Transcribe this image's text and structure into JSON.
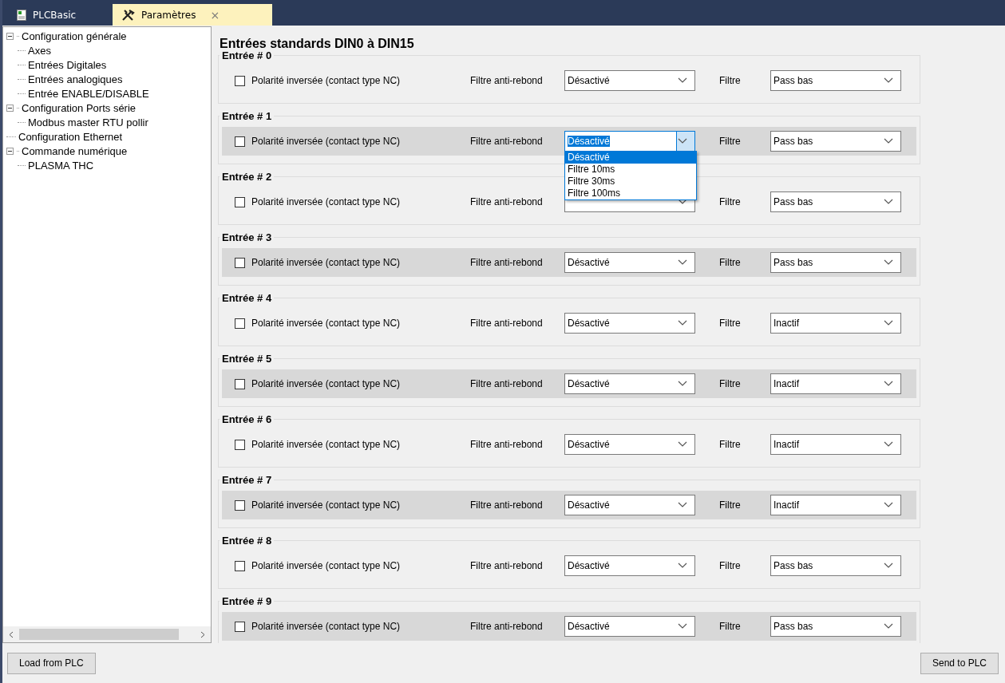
{
  "tabs": [
    {
      "label": "PLCBasic",
      "selected": false,
      "kind": "document"
    },
    {
      "label": "Paramètres",
      "selected": true,
      "kind": "tools",
      "close": "×"
    }
  ],
  "tree": [
    {
      "label": "Configuration  générale",
      "expanded": true,
      "children": [
        {
          "label": "Axes"
        },
        {
          "label": "Entrées Digitales"
        },
        {
          "label": "Entrées analogiques"
        },
        {
          "label": "Entrée ENABLE/DISABLE"
        }
      ]
    },
    {
      "label": "Configuration Ports série",
      "expanded": true,
      "children": [
        {
          "label": "Modbus master RTU pollir"
        }
      ]
    },
    {
      "label": "Configuration Ethernet"
    },
    {
      "label": "Commande numérique",
      "expanded": true,
      "children": [
        {
          "label": "PLASMA THC"
        }
      ]
    }
  ],
  "section_title": "Entrées standards DIN0 à DIN15",
  "inputs": [
    {
      "title": "Entrée # 0",
      "checked": false,
      "polarity": "Polarité inversée (contact type NC)",
      "debounce_label": "Filtre anti-rebond",
      "debounce": "Désactivé",
      "filter_label": "Filtre",
      "filter": "Pass bas"
    },
    {
      "title": "Entrée # 1",
      "checked": false,
      "polarity": "Polarité inversée (contact type NC)",
      "debounce_label": "Filtre anti-rebond",
      "debounce": "Désactivé",
      "filter_label": "Filtre",
      "filter": "Pass bas",
      "open": true,
      "options": [
        {
          "label": "Désactivé",
          "selected": true
        },
        {
          "label": "Filtre 10ms",
          "selected": false
        },
        {
          "label": "Filtre 30ms",
          "selected": false
        },
        {
          "label": "Filtre 100ms",
          "selected": false
        }
      ]
    },
    {
      "title": "Entrée # 2",
      "checked": false,
      "polarity": "Polarité inversée (contact type NC)",
      "debounce_label": "Filtre anti-rebond",
      "filter_label": "Filtre",
      "filter": "Pass bas"
    },
    {
      "title": "Entrée # 3",
      "checked": false,
      "polarity": "Polarité inversée (contact type NC)",
      "debounce_label": "Filtre anti-rebond",
      "debounce": "Désactivé",
      "filter_label": "Filtre",
      "filter": "Pass bas"
    },
    {
      "title": "Entrée # 4",
      "checked": false,
      "polarity": "Polarité inversée (contact type NC)",
      "debounce_label": "Filtre anti-rebond",
      "debounce": "Désactivé",
      "filter_label": "Filtre",
      "filter": "Inactif"
    },
    {
      "title": "Entrée # 5",
      "checked": false,
      "polarity": "Polarité inversée (contact type NC)",
      "debounce_label": "Filtre anti-rebond",
      "debounce": "Désactivé",
      "filter_label": "Filtre",
      "filter": "Inactif"
    },
    {
      "title": "Entrée # 6",
      "checked": false,
      "polarity": "Polarité inversée (contact type NC)",
      "debounce_label": "Filtre anti-rebond",
      "debounce": "Désactivé",
      "filter_label": "Filtre",
      "filter": "Inactif"
    },
    {
      "title": "Entrée # 7",
      "checked": false,
      "polarity": "Polarité inversée (contact type NC)",
      "debounce_label": "Filtre anti-rebond",
      "debounce": "Désactivé",
      "filter_label": "Filtre",
      "filter": "Inactif"
    },
    {
      "title": "Entrée # 8",
      "checked": false,
      "polarity": "Polarité inversée (contact type NC)",
      "debounce_label": "Filtre anti-rebond",
      "debounce": "Désactivé",
      "filter_label": "Filtre",
      "filter": "Pass bas"
    },
    {
      "title": "Entrée # 9",
      "checked": false,
      "polarity": "Polarité inversée (contact type NC)",
      "debounce_label": "Filtre anti-rebond",
      "debounce": "Désactivé",
      "filter_label": "Filtre",
      "filter": "Pass bas"
    }
  ],
  "buttons": {
    "load": "Load from PLC",
    "send": "Send to PLC"
  }
}
